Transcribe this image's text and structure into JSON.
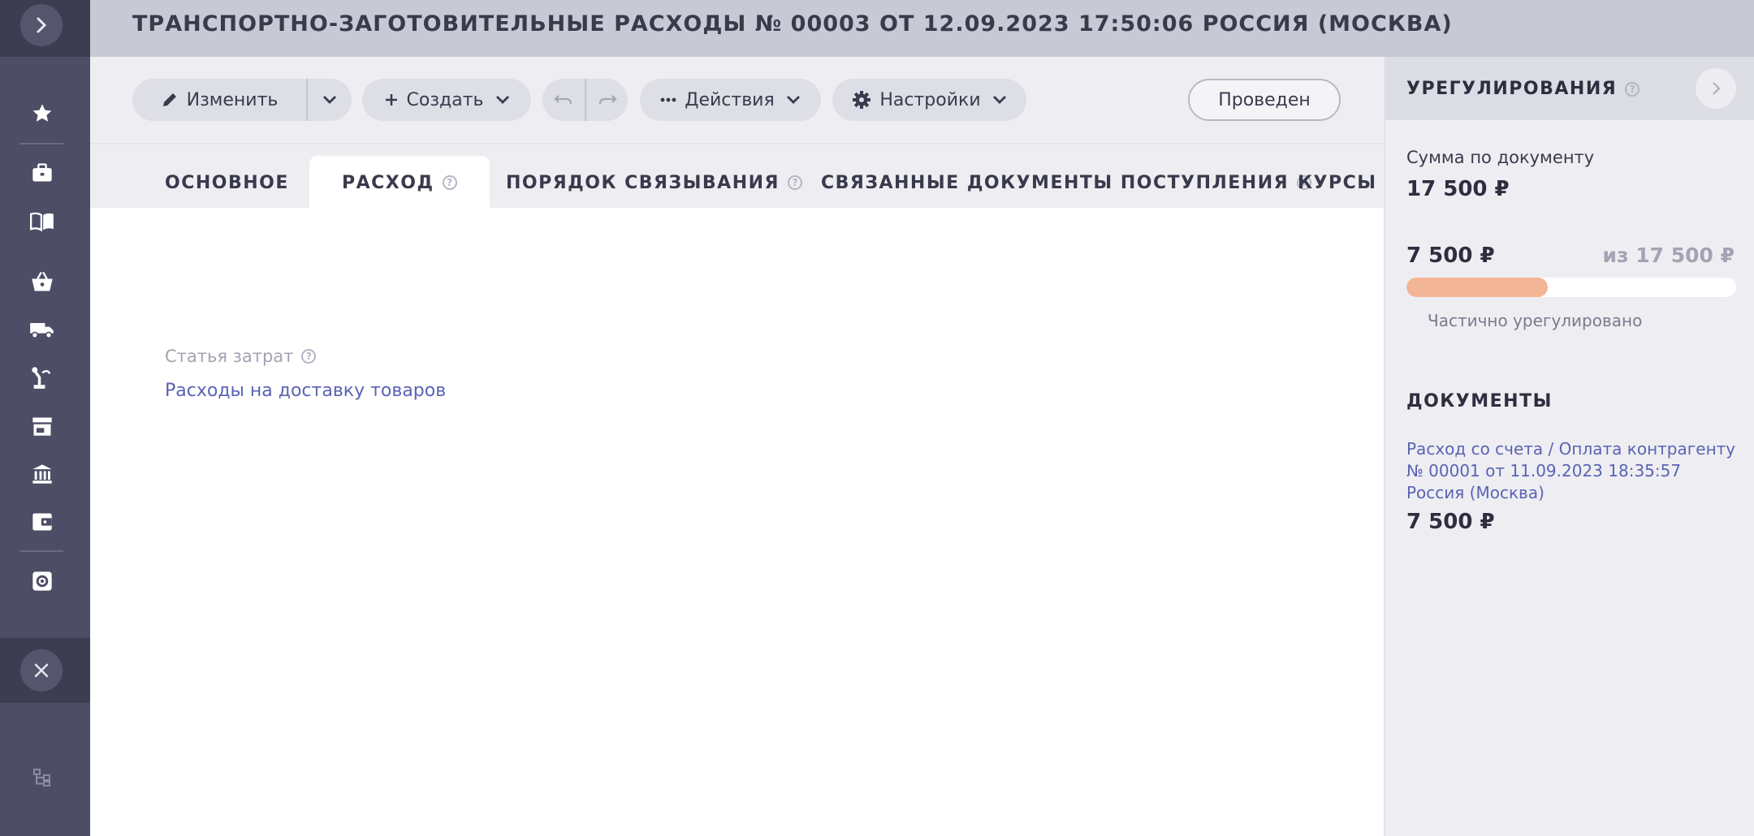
{
  "header": {
    "title": "ТРАНСПОРТНО-ЗАГОТОВИТЕЛЬНЫЕ РАСХОДЫ № 00003 ОТ 12.09.2023 17:50:06 РОССИЯ (МОСКВА)"
  },
  "sidebar": {
    "items": [
      {
        "icon": "star-icon"
      },
      {
        "icon": "briefcase-icon"
      },
      {
        "icon": "book-icon"
      },
      {
        "icon": "basket-icon"
      },
      {
        "icon": "truck-icon"
      },
      {
        "icon": "robot-arm-icon"
      },
      {
        "icon": "store-icon"
      },
      {
        "icon": "bank-icon"
      },
      {
        "icon": "wallet-icon"
      },
      {
        "icon": "settings-icon"
      }
    ]
  },
  "toolbar": {
    "edit_label": "Изменить",
    "create_label": "Создать",
    "actions_label": "Действия",
    "settings_label": "Настройки",
    "status_label": "Проведен"
  },
  "tabs": [
    {
      "label": "ОСНОВНОЕ",
      "active": false
    },
    {
      "label": "РАСХОД",
      "active": true
    },
    {
      "label": "ПОРЯДОК СВЯЗЫВАНИЯ",
      "active": false
    },
    {
      "label": "СВЯЗАННЫЕ ДОКУМЕНТЫ ПОСТУПЛЕНИЯ",
      "active": false
    },
    {
      "label": "КУРСЫ",
      "active": false
    }
  ],
  "main": {
    "cost_item_label": "Статья затрат",
    "cost_item_value": "Расходы на доставку товаров"
  },
  "settlement": {
    "title": "УРЕГУЛИРОВАНИЯ",
    "sum_label": "Сумма по документу",
    "sum_value": "17 500 ₽",
    "settled_value": "7 500 ₽",
    "of_total": "из 17 500 ₽",
    "progress_fraction": 0.4286,
    "progress_color": "#f2b596",
    "status": "Частично урегулировано",
    "documents_title": "ДОКУМЕНТЫ",
    "documents": [
      {
        "link": "Расход со счета / Оплата контрагенту № 00001 от 11.09.2023 18:35:57 Россия (Москва)",
        "amount": "7 500 ₽"
      }
    ]
  }
}
